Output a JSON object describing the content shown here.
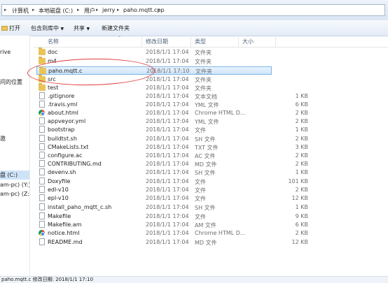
{
  "address_bar": {
    "crumbs": [
      "计算机",
      "本地磁盘 (C:)",
      "用户",
      "jerry",
      "paho.mqtt.cpp"
    ]
  },
  "toolbar": {
    "open_label": "打开",
    "include_label": "包含到库中",
    "share_label": "共享",
    "new_folder_label": "新建文件夹"
  },
  "nav": {
    "items": [
      "rive",
      "问的位置",
      "邀",
      "盘 (C:)",
      "am-pc) (Y:)",
      "am-pc) (Z:)"
    ]
  },
  "columns": {
    "name": "名称",
    "date": "修改日期",
    "type": "类型",
    "size": "大小"
  },
  "files": [
    {
      "name": "doc",
      "date": "2018/1/1 17:04",
      "type": "文件夹",
      "size": "",
      "icon": "folder-icon"
    },
    {
      "name": "m4",
      "date": "2018/1/1 17:04",
      "type": "文件夹",
      "size": "",
      "icon": "folder-icon"
    },
    {
      "name": "paho.mqtt.c",
      "date": "2018/1/1 17:10",
      "type": "文件夹",
      "size": "",
      "icon": "folder-icon",
      "selected": true
    },
    {
      "name": "src",
      "date": "2018/1/1 17:04",
      "type": "文件夹",
      "size": "",
      "icon": "folder-icon"
    },
    {
      "name": "test",
      "date": "2018/1/1 17:04",
      "type": "文件夹",
      "size": "",
      "icon": "folder-icon"
    },
    {
      "name": ".gitignore",
      "date": "2018/1/1 17:04",
      "type": "文本文档",
      "size": "1 KB",
      "icon": "file-icon"
    },
    {
      "name": ".travis.yml",
      "date": "2018/1/1 17:04",
      "type": "YML 文件",
      "size": "6 KB",
      "icon": "file-icon"
    },
    {
      "name": "about.html",
      "date": "2018/1/1 17:04",
      "type": "Chrome HTML D...",
      "size": "2 KB",
      "icon": "chrome-icon"
    },
    {
      "name": "appveyor.yml",
      "date": "2018/1/1 17:04",
      "type": "YML 文件",
      "size": "2 KB",
      "icon": "file-icon"
    },
    {
      "name": "bootstrap",
      "date": "2018/1/1 17:04",
      "type": "文件",
      "size": "1 KB",
      "icon": "file-icon"
    },
    {
      "name": "buildtst.sh",
      "date": "2018/1/1 17:04",
      "type": "SH 文件",
      "size": "2 KB",
      "icon": "file-icon"
    },
    {
      "name": "CMakeLists.txt",
      "date": "2018/1/1 17:04",
      "type": "TXT 文件",
      "size": "3 KB",
      "icon": "file-icon"
    },
    {
      "name": "configure.ac",
      "date": "2018/1/1 17:04",
      "type": "AC 文件",
      "size": "2 KB",
      "icon": "file-icon"
    },
    {
      "name": "CONTRIBUTING.md",
      "date": "2018/1/1 17:04",
      "type": "MD 文件",
      "size": "2 KB",
      "icon": "file-icon"
    },
    {
      "name": "devenv.sh",
      "date": "2018/1/1 17:04",
      "type": "SH 文件",
      "size": "1 KB",
      "icon": "file-icon"
    },
    {
      "name": "Doxyfile",
      "date": "2018/1/1 17:04",
      "type": "文件",
      "size": "101 KB",
      "icon": "file-icon"
    },
    {
      "name": "edl-v10",
      "date": "2018/1/1 17:04",
      "type": "文件",
      "size": "2 KB",
      "icon": "file-icon"
    },
    {
      "name": "epl-v10",
      "date": "2018/1/1 17:04",
      "type": "文件",
      "size": "12 KB",
      "icon": "file-icon"
    },
    {
      "name": "install_paho_mqtt_c.sh",
      "date": "2018/1/1 17:04",
      "type": "SH 文件",
      "size": "1 KB",
      "icon": "file-icon"
    },
    {
      "name": "Makefile",
      "date": "2018/1/1 17:04",
      "type": "文件",
      "size": "9 KB",
      "icon": "file-icon"
    },
    {
      "name": "Makefile.am",
      "date": "2018/1/1 17:04",
      "type": "AM 文件",
      "size": "6 KB",
      "icon": "file-icon"
    },
    {
      "name": "notice.html",
      "date": "2018/1/1 17:04",
      "type": "Chrome HTML D...",
      "size": "2 KB",
      "icon": "chrome-icon"
    },
    {
      "name": "README.md",
      "date": "2018/1/1 17:04",
      "type": "MD 文件",
      "size": "12 KB",
      "icon": "file-icon"
    }
  ],
  "status_bar": {
    "text": "paho.mqtt.c   修改日期: 2018/1/1 17:10"
  },
  "colors": {
    "selection": "#cde4fb",
    "annotation_ellipse": "#e03b3b",
    "folder": "#e9c45a"
  }
}
